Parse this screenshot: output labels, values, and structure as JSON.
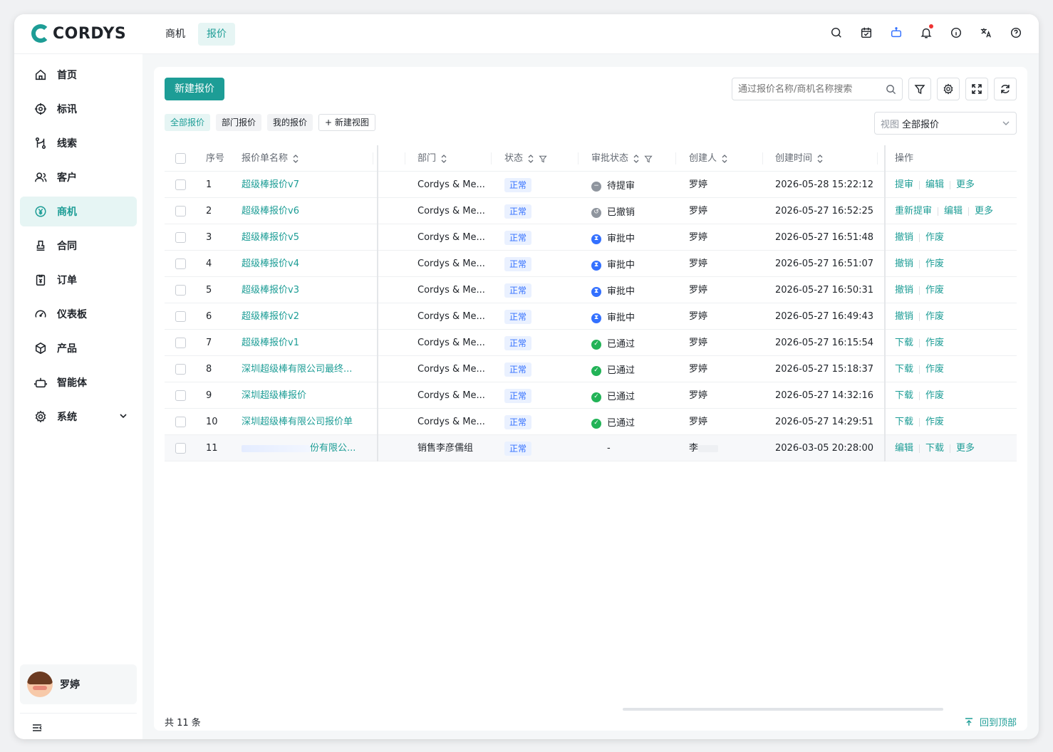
{
  "app": {
    "logo_text": "CORDYS"
  },
  "top_nav": [
    {
      "label": "商机",
      "active": false
    },
    {
      "label": "报价",
      "active": true
    }
  ],
  "header_icons": [
    "search-icon",
    "calendar-icon",
    "robot-icon",
    "bell-icon",
    "info-icon",
    "translate-icon",
    "help-icon"
  ],
  "sidebar": {
    "items": [
      {
        "label": "首页",
        "icon": "home-icon"
      },
      {
        "label": "标讯",
        "icon": "target-icon"
      },
      {
        "label": "线索",
        "icon": "branch-icon"
      },
      {
        "label": "客户",
        "icon": "users-icon"
      },
      {
        "label": "商机",
        "icon": "yen-icon",
        "active": true
      },
      {
        "label": "合同",
        "icon": "stamp-icon"
      },
      {
        "label": "订单",
        "icon": "order-icon"
      },
      {
        "label": "仪表板",
        "icon": "gauge-icon"
      },
      {
        "label": "产品",
        "icon": "box-icon"
      },
      {
        "label": "智能体",
        "icon": "robot-icon"
      },
      {
        "label": "系统",
        "icon": "gear-icon",
        "has_children": true
      }
    ],
    "user": {
      "name": "罗婷"
    }
  },
  "toolbar": {
    "new_button": "新建报价",
    "search_placeholder": "通过报价名称/商机名称搜索"
  },
  "tabs": [
    {
      "label": "全部报价",
      "active": true
    },
    {
      "label": "部门报价",
      "active": false
    },
    {
      "label": "我的报价",
      "active": false
    },
    {
      "label": "+ 新建视图",
      "active": false
    }
  ],
  "view_select": {
    "label": "视图",
    "value": "全部报价"
  },
  "table": {
    "columns": {
      "index": "序号",
      "name": "报价单名称",
      "dept": "部门",
      "status": "状态",
      "approval": "审批状态",
      "creator": "创建人",
      "created": "创建时间",
      "ops": "操作"
    },
    "rows": [
      {
        "index": "1",
        "name": "超级棒报价v7",
        "dept": "Cordys & Me...",
        "status": "正常",
        "approval": "待提审",
        "approval_type": "pending",
        "creator": "罗婷",
        "created": "2026-05-28 15:22:12",
        "ops": [
          "提审",
          "编辑",
          "更多"
        ]
      },
      {
        "index": "2",
        "name": "超级棒报价v6",
        "dept": "Cordys & Me...",
        "status": "正常",
        "approval": "已撤销",
        "approval_type": "revoked",
        "creator": "罗婷",
        "created": "2026-05-27 16:52:25",
        "ops": [
          "重新提审",
          "编辑",
          "更多"
        ]
      },
      {
        "index": "3",
        "name": "超级棒报价v5",
        "dept": "Cordys & Me...",
        "status": "正常",
        "approval": "审批中",
        "approval_type": "approving",
        "creator": "罗婷",
        "created": "2026-05-27 16:51:48",
        "ops": [
          "撤销",
          "作废"
        ]
      },
      {
        "index": "4",
        "name": "超级棒报价v4",
        "dept": "Cordys & Me...",
        "status": "正常",
        "approval": "审批中",
        "approval_type": "approving",
        "creator": "罗婷",
        "created": "2026-05-27 16:51:07",
        "ops": [
          "撤销",
          "作废"
        ]
      },
      {
        "index": "5",
        "name": "超级棒报价v3",
        "dept": "Cordys & Me...",
        "status": "正常",
        "approval": "审批中",
        "approval_type": "approving",
        "creator": "罗婷",
        "created": "2026-05-27 16:50:31",
        "ops": [
          "撤销",
          "作废"
        ]
      },
      {
        "index": "6",
        "name": "超级棒报价v2",
        "dept": "Cordys & Me...",
        "status": "正常",
        "approval": "审批中",
        "approval_type": "approving",
        "creator": "罗婷",
        "created": "2026-05-27 16:49:43",
        "ops": [
          "撤销",
          "作废"
        ]
      },
      {
        "index": "7",
        "name": "超级棒报价v1",
        "dept": "Cordys & Me...",
        "status": "正常",
        "approval": "已通过",
        "approval_type": "approved",
        "creator": "罗婷",
        "created": "2026-05-27 16:15:54",
        "ops": [
          "下载",
          "作废"
        ]
      },
      {
        "index": "8",
        "name": "深圳超级棒有限公司最终...",
        "dept": "Cordys & Me...",
        "status": "正常",
        "approval": "已通过",
        "approval_type": "approved",
        "creator": "罗婷",
        "created": "2026-05-27 15:18:37",
        "ops": [
          "下载",
          "作废"
        ]
      },
      {
        "index": "9",
        "name": "深圳超级棒报价",
        "dept": "Cordys & Me...",
        "status": "正常",
        "approval": "已通过",
        "approval_type": "approved",
        "creator": "罗婷",
        "created": "2026-05-27 14:32:16",
        "ops": [
          "下载",
          "作废"
        ]
      },
      {
        "index": "10",
        "name": "深圳超级棒有限公司报价单",
        "dept": "Cordys & Me...",
        "status": "正常",
        "approval": "已通过",
        "approval_type": "approved",
        "creator": "罗婷",
        "created": "2026-05-27 14:29:51",
        "ops": [
          "下载",
          "作废"
        ]
      },
      {
        "index": "11",
        "name": "份有限公...",
        "dept": "销售李彦儒组",
        "status": "正常",
        "approval": "-",
        "approval_type": "none",
        "creator": "李",
        "created": "2026-03-05 20:28:00",
        "ops": [
          "编辑",
          "下载",
          "更多"
        ]
      }
    ]
  },
  "footer": {
    "count": "共 11 条",
    "back_top": "回到顶部"
  },
  "colors": {
    "accent": "#1d9d96",
    "accent_bg": "#e6f5f4",
    "badge_blue": "#3370ff",
    "approved": "#22b357",
    "approving": "#3370ff",
    "pending": "#646a73"
  }
}
